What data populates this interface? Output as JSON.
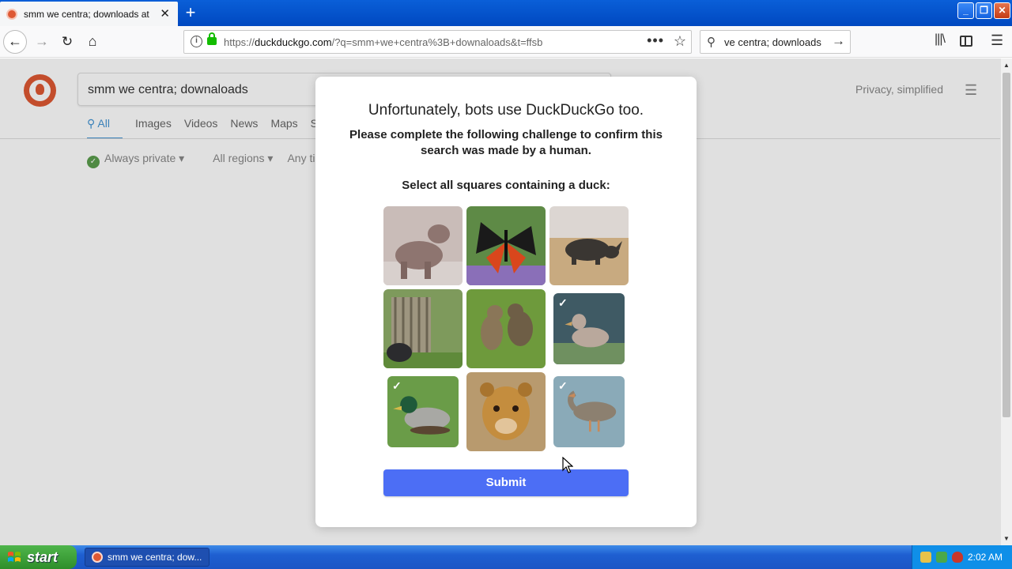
{
  "browser": {
    "tab_title": "smm we centra; downloads at DuckDuckGo",
    "url_host_prefix": "https://",
    "url_host": "duckduckgo.com",
    "url_rest": "/?q=smm+we+centra%3B+downaloads&t=ffsb",
    "search_text": "ve centra; downloads",
    "new_tab_label": "+"
  },
  "page": {
    "search_query": "smm we centra; downaloads",
    "privacy_link": "Privacy, simplified",
    "tabs": [
      "All",
      "Images",
      "Videos",
      "News",
      "Maps",
      "Sh"
    ],
    "filters": [
      "Always private ▾",
      "All regions ▾",
      "Any tim"
    ]
  },
  "modal": {
    "title": "Unfortunately, bots use DuckDuckGo too.",
    "instructions": "Please complete the following challenge to confirm this search was made by a human.",
    "prompt": "Select all squares containing a duck:",
    "submit_label": "Submit",
    "tiles": [
      {
        "subject": "dog",
        "selected": false
      },
      {
        "subject": "butterfly",
        "selected": false
      },
      {
        "subject": "rhinoceros",
        "selected": false
      },
      {
        "subject": "bird-by-fence",
        "selected": false
      },
      {
        "subject": "cats",
        "selected": false
      },
      {
        "subject": "duck",
        "selected": true
      },
      {
        "subject": "mallard-duck",
        "selected": true
      },
      {
        "subject": "lion-cub",
        "selected": false
      },
      {
        "subject": "goose",
        "selected": true
      }
    ]
  },
  "taskbar": {
    "start_label": "start",
    "task_label": "smm we centra; dow...",
    "clock": "2:02 AM"
  },
  "colors": {
    "ddg_orange": "#de5833",
    "submit_blue": "#4c6ef5",
    "xp_blue": "#1e5fd1",
    "xp_green": "#2e8e2a"
  }
}
